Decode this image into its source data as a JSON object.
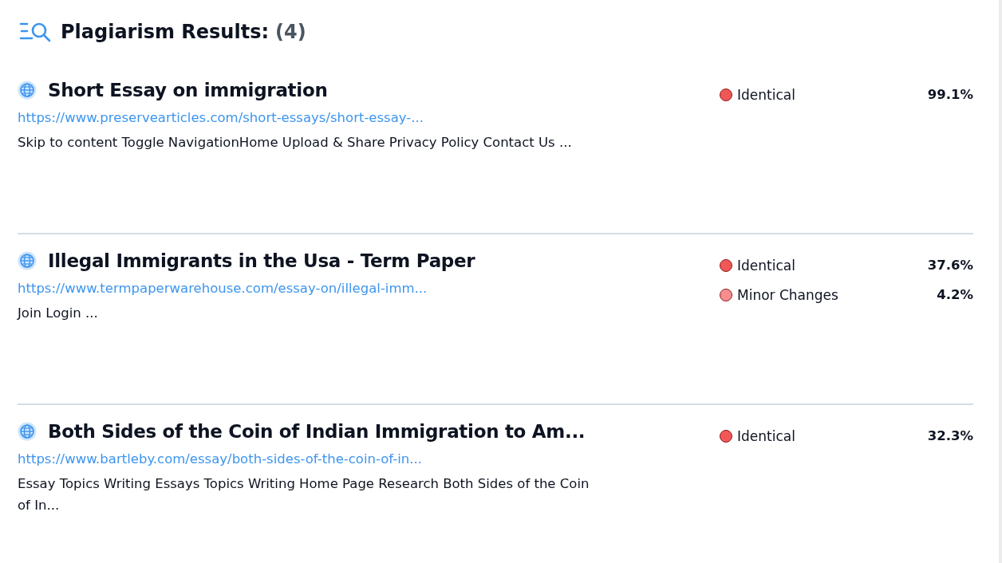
{
  "header": {
    "title": "Plagiarism Results:",
    "count": "(4)"
  },
  "results": [
    {
      "title": "Short Essay on immigration",
      "url": "https://www.preservearticles.com/short-essays/short-essay-...",
      "snippet": "Skip to content Toggle NavigationHome Upload & Share Privacy Policy Contact Us ...",
      "matches": [
        {
          "label": "Identical",
          "color": "#f25757",
          "percent": "99.1%"
        }
      ]
    },
    {
      "title": "Illegal Immigrants in the Usa - Term Paper",
      "url": "https://www.termpaperwarehouse.com/essay-on/illegal-imm...",
      "snippet": "Join Login ...",
      "matches": [
        {
          "label": "Identical",
          "color": "#f25757",
          "percent": "37.6%"
        },
        {
          "label": "Minor Changes",
          "color": "#f78e8e",
          "percent": "4.2%"
        }
      ]
    },
    {
      "title": "Both Sides of the Coin of Indian Immigration to Am...",
      "url": "https://www.bartleby.com/essay/both-sides-of-the-coin-of-in...",
      "snippet": "Essay Topics Writing Essays Topics Writing Home Page Research Both Sides of the Coin of In...",
      "matches": [
        {
          "label": "Identical",
          "color": "#f25757",
          "percent": "32.3%"
        }
      ]
    }
  ]
}
